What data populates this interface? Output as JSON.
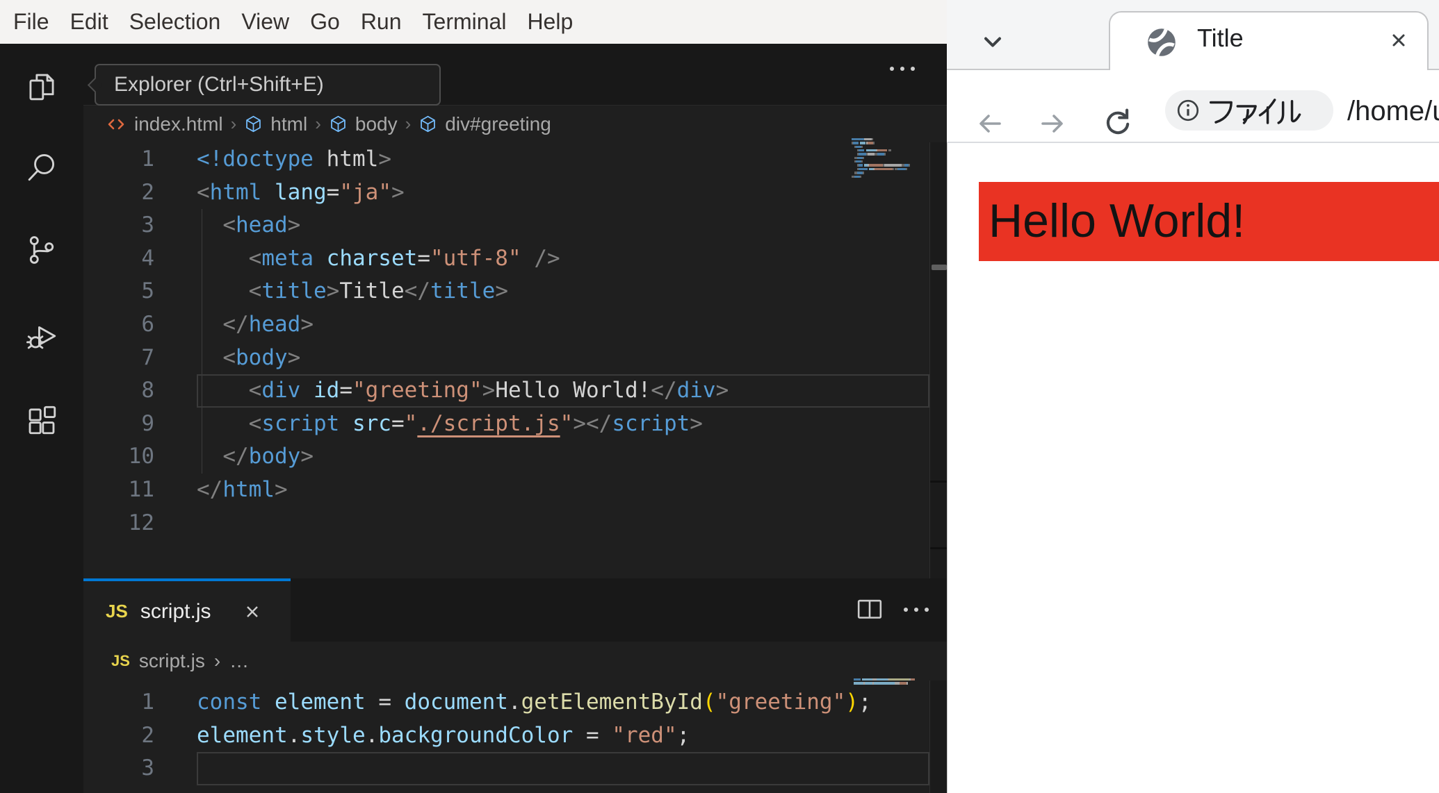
{
  "vscode": {
    "menu_items": [
      "File",
      "Edit",
      "Selection",
      "View",
      "Go",
      "Run",
      "Terminal",
      "Help"
    ],
    "tooltip": "Explorer (Ctrl+Shift+E)",
    "activity_icons": [
      "explorer",
      "search",
      "source-control",
      "run-and-debug",
      "extensions"
    ],
    "editor": {
      "breadcrumb": {
        "file": "index.html",
        "segments": [
          "html",
          "body",
          "div#greeting"
        ],
        "separator": "›"
      },
      "lines": [
        [
          [
            "tag",
            "<!doctype"
          ],
          [
            "text",
            " html"
          ],
          [
            "punct",
            ">"
          ]
        ],
        [
          [
            "punct",
            "<"
          ],
          [
            "tag",
            "html"
          ],
          [
            "text",
            " "
          ],
          [
            "attr",
            "lang"
          ],
          [
            "text",
            "="
          ],
          [
            "str",
            "\"ja\""
          ],
          [
            "punct",
            ">"
          ]
        ],
        [
          [
            "text",
            "  "
          ],
          [
            "punct",
            "<"
          ],
          [
            "tag",
            "head"
          ],
          [
            "punct",
            ">"
          ]
        ],
        [
          [
            "text",
            "    "
          ],
          [
            "punct",
            "<"
          ],
          [
            "tag",
            "meta"
          ],
          [
            "text",
            " "
          ],
          [
            "attr",
            "charset"
          ],
          [
            "text",
            "="
          ],
          [
            "str",
            "\"utf-8\""
          ],
          [
            "text",
            " "
          ],
          [
            "punct",
            "/>"
          ]
        ],
        [
          [
            "text",
            "    "
          ],
          [
            "punct",
            "<"
          ],
          [
            "tag",
            "title"
          ],
          [
            "punct",
            ">"
          ],
          [
            "text",
            "Title"
          ],
          [
            "punct",
            "</"
          ],
          [
            "tag",
            "title"
          ],
          [
            "punct",
            ">"
          ]
        ],
        [
          [
            "text",
            "  "
          ],
          [
            "punct",
            "</"
          ],
          [
            "tag",
            "head"
          ],
          [
            "punct",
            ">"
          ]
        ],
        [
          [
            "text",
            "  "
          ],
          [
            "punct",
            "<"
          ],
          [
            "tag",
            "body"
          ],
          [
            "punct",
            ">"
          ]
        ],
        [
          [
            "text",
            "    "
          ],
          [
            "punct",
            "<"
          ],
          [
            "tag",
            "div"
          ],
          [
            "text",
            " "
          ],
          [
            "attr",
            "id"
          ],
          [
            "text",
            "="
          ],
          [
            "str",
            "\"greeting\""
          ],
          [
            "punct",
            ">"
          ],
          [
            "text",
            "Hello World!"
          ],
          [
            "punct",
            "</"
          ],
          [
            "tag",
            "div"
          ],
          [
            "punct",
            ">"
          ]
        ],
        [
          [
            "text",
            "    "
          ],
          [
            "punct",
            "<"
          ],
          [
            "tag",
            "script"
          ],
          [
            "text",
            " "
          ],
          [
            "attr",
            "src"
          ],
          [
            "text",
            "="
          ],
          [
            "str",
            "\""
          ],
          [
            "link",
            "./script.js"
          ],
          [
            "str",
            "\""
          ],
          [
            "punct",
            ">"
          ],
          [
            "punct",
            "</"
          ],
          [
            "tag",
            "script"
          ],
          [
            "punct",
            ">"
          ]
        ],
        [
          [
            "text",
            "  "
          ],
          [
            "punct",
            "</"
          ],
          [
            "tag",
            "body"
          ],
          [
            "punct",
            ">"
          ]
        ],
        [
          [
            "punct",
            "</"
          ],
          [
            "tag",
            "html"
          ],
          [
            "punct",
            ">"
          ]
        ],
        []
      ],
      "active_line": 8
    },
    "panel": {
      "tab": {
        "badge": "JS",
        "label": "script.js"
      },
      "breadcrumb": {
        "badge": "JS",
        "file": "script.js",
        "separator": "›",
        "more": "…"
      },
      "lines": [
        [
          [
            "kw",
            "const"
          ],
          [
            "text",
            " "
          ],
          [
            "var",
            "element"
          ],
          [
            "text",
            " = "
          ],
          [
            "var",
            "document"
          ],
          [
            "text",
            "."
          ],
          [
            "fn",
            "getElementById"
          ],
          [
            "paren",
            "("
          ],
          [
            "str",
            "\"greeting\""
          ],
          [
            "paren",
            ")"
          ],
          [
            "text",
            ";"
          ]
        ],
        [
          [
            "var",
            "element"
          ],
          [
            "text",
            "."
          ],
          [
            "var",
            "style"
          ],
          [
            "text",
            "."
          ],
          [
            "var",
            "backgroundColor"
          ],
          [
            "text",
            " = "
          ],
          [
            "str",
            "\"red\""
          ],
          [
            "text",
            ";"
          ]
        ],
        []
      ],
      "active_line": 3
    }
  },
  "browser": {
    "tab": {
      "title": "Title"
    },
    "toolbar": {
      "chip_label": "ファイル",
      "url": "/home/u"
    },
    "page": {
      "heading": "Hello World!"
    }
  },
  "colors": {
    "accent": "#0078d4",
    "red_background": "#e93323",
    "js_badge": "#e8d44d",
    "tag_blue": "#569cd6",
    "string_orange": "#ce9178"
  }
}
